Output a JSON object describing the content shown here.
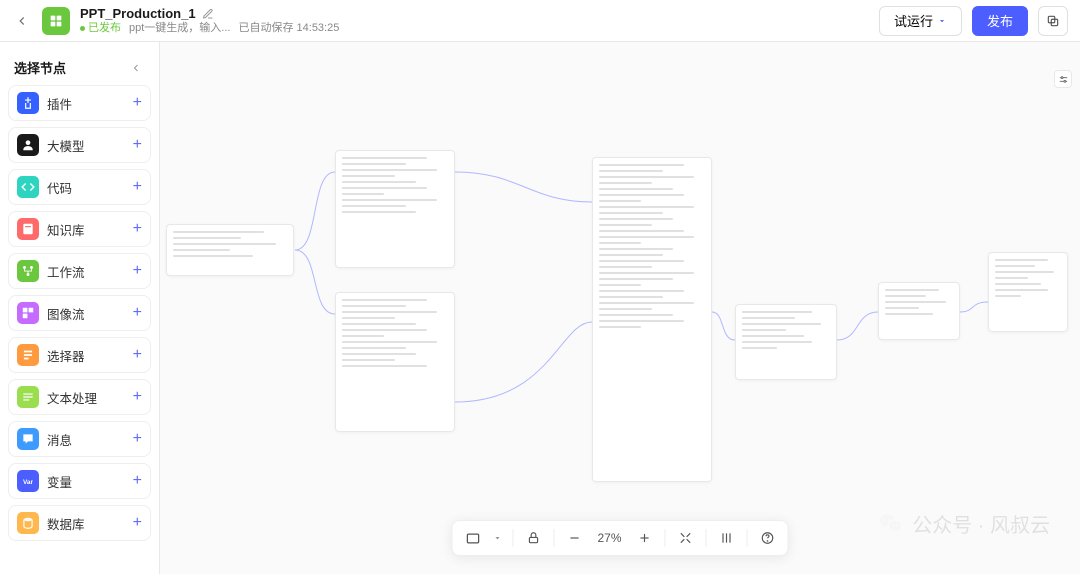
{
  "header": {
    "title": "PPT_Production_1",
    "published_label": "已发布",
    "description": "ppt一键生成，输入...",
    "autosave_label": "已自动保存 14:53:25",
    "btn_run": "试运行",
    "btn_publish": "发布"
  },
  "sidebar": {
    "title": "选择节点",
    "items": [
      {
        "label": "插件",
        "icon": "plugin",
        "bg": "#3562ff"
      },
      {
        "label": "大模型",
        "icon": "llm",
        "bg": "#1a1a1a"
      },
      {
        "label": "代码",
        "icon": "code",
        "bg": "#2dd4bf"
      },
      {
        "label": "知识库",
        "icon": "kb",
        "bg": "#ff6b6b"
      },
      {
        "label": "工作流",
        "icon": "workflow",
        "bg": "#6bc83e"
      },
      {
        "label": "图像流",
        "icon": "imageflow",
        "bg": "#c66bff"
      },
      {
        "label": "选择器",
        "icon": "selector",
        "bg": "#ff9a3e"
      },
      {
        "label": "文本处理",
        "icon": "text",
        "bg": "#9ade4f"
      },
      {
        "label": "消息",
        "icon": "message",
        "bg": "#3d9aff"
      },
      {
        "label": "变量",
        "icon": "var",
        "bg": "#4c5eff"
      },
      {
        "label": "数据库",
        "icon": "db",
        "bg": "#ffb84d"
      }
    ]
  },
  "toolbar": {
    "zoom": "27%"
  },
  "watermark": {
    "text": "公众号 · 风叔云"
  }
}
